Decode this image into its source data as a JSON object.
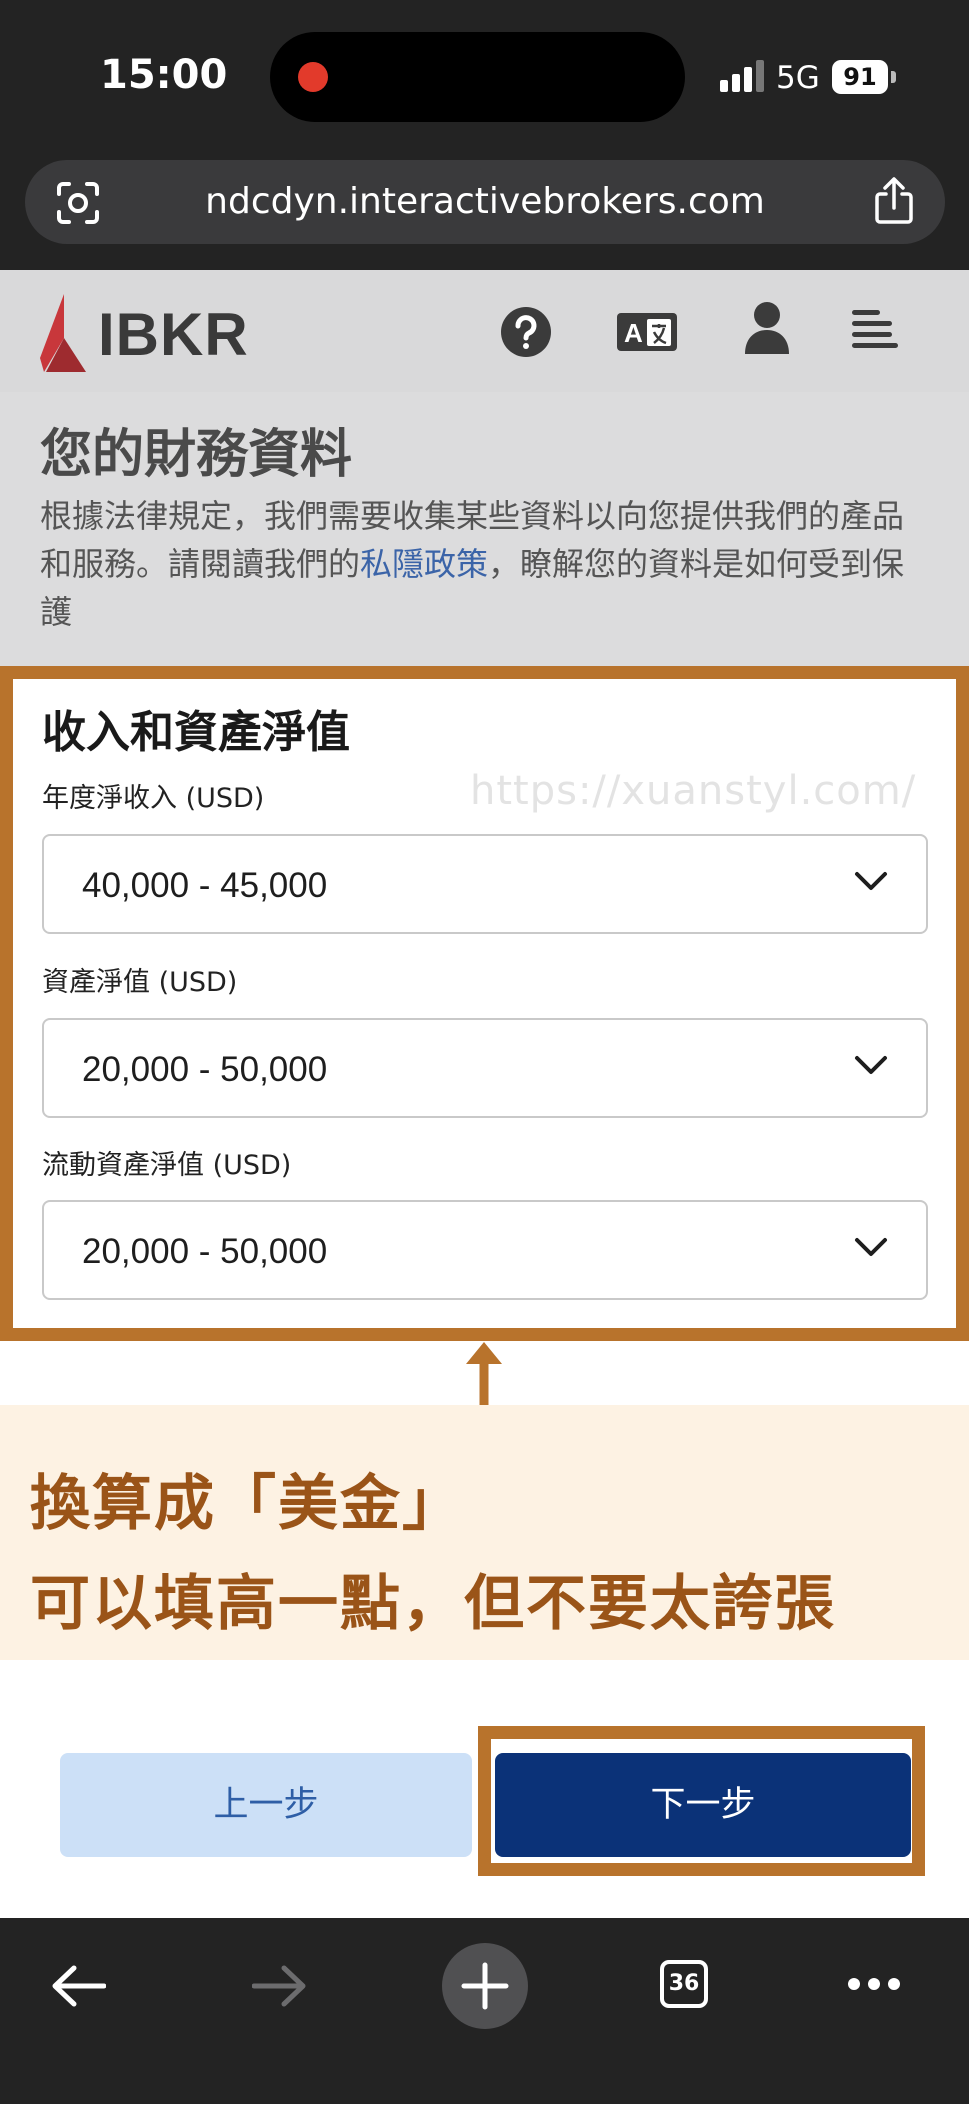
{
  "status_bar": {
    "time": "15:00",
    "network": "5G",
    "battery": "91",
    "icons": [
      "recording-dot-icon",
      "signal-icon",
      "battery-icon"
    ]
  },
  "browser": {
    "url": "ndcdyn.interactivebrokers.com",
    "tab_count": "36",
    "icons": [
      "camera-scan-icon",
      "share-icon",
      "back-icon",
      "forward-icon",
      "new-tab-icon",
      "tabs-icon",
      "more-icon"
    ]
  },
  "header": {
    "logo_text": "IBKR",
    "icons": [
      "help-icon",
      "language-icon",
      "user-icon",
      "menu-icon"
    ]
  },
  "intro": {
    "title": "您的財務資料",
    "text_before": "根據法律規定，我們需要收集某些資料以向您提供我們的產品和服務。請閱讀我們的",
    "link": "私隱政策",
    "text_after": "，瞭解您的資料是如何受到保護"
  },
  "form": {
    "section_title": "收入和資產淨值",
    "watermark": "https://xuanstyl.com/",
    "fields": [
      {
        "label": "年度淨收入 (USD)",
        "value": "40,000 - 45,000"
      },
      {
        "label": "資產淨值 (USD)",
        "value": "20,000 - 50,000"
      },
      {
        "label": "流動資產淨值 (USD)",
        "value": "20,000 - 50,000"
      }
    ]
  },
  "annotation": {
    "line1": "換算成「美金」",
    "line2": "可以填高一點，但不要太誇張",
    "color": "#b8732c"
  },
  "buttons": {
    "prev": "上一步",
    "next": "下一步"
  },
  "colors": {
    "primary": "#0b3278",
    "secondary": "#cce0f7",
    "link": "#3b64a8",
    "highlight": "#b8732c"
  }
}
